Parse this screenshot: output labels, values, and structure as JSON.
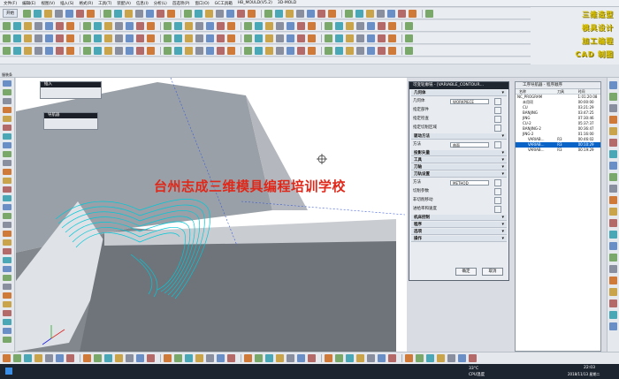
{
  "menu": [
    "文件(F)",
    "编辑(E)",
    "视图(V)",
    "插入(S)",
    "格式(R)",
    "工具(T)",
    "装配(A)",
    "信息(I)",
    "分析(L)",
    "首选项(P)",
    "窗口(O)",
    "GC工具箱",
    "HB_MOULD(V5.2)",
    "3D-MOLD"
  ],
  "start_label": "开始",
  "cad_lines": [
    "三维造型",
    "模具设计",
    "加工编程",
    "CAD 制图"
  ],
  "resource_bar_label": "服装条",
  "watermark": "台州志成三维模具编程培训学校",
  "float_insert_title": "插入",
  "float_nav_title": "导航器",
  "dialog": {
    "title": "可变轮廓铣 - [VARIABLE_CONTOUR…",
    "sec_geometry": "几何体",
    "geometry_label": "几何体",
    "geometry_value": "WORKPIECE",
    "part_label": "指定部件",
    "check_label": "指定检查",
    "cut_area_label": "指定切削区域",
    "sec_drive": "驱动方法",
    "method_label": "方法",
    "method_value": "曲面",
    "sec_proj": "投影矢量",
    "sec_tool": "工具",
    "sec_axis": "刀轴",
    "sec_ops": "刀轨设置",
    "ops_method_label": "方法",
    "ops_method_value": "METHOD",
    "cut_param_label": "切削参数",
    "noncut_label": "非切削移动",
    "feed_label": "进给率和速度",
    "sec_machine": "机床控制",
    "sec_program": "程序",
    "sec_options": "选项",
    "sec_actions": "操作",
    "ok": "确定",
    "cancel": "取消"
  },
  "nav": {
    "title": "工序导航器 - 程序顺序",
    "columns": [
      "名称",
      "刀具",
      "时间"
    ],
    "rows": [
      {
        "name": "NC_PROGRAM",
        "tool": "",
        "time": "1:01:20:08"
      },
      {
        "name": "未用项",
        "tool": "",
        "time": "00:00:00"
      },
      {
        "name": "CU",
        "tool": "",
        "time": "03:21:29"
      },
      {
        "name": "BANJING",
        "tool": "",
        "time": "03:47:25"
      },
      {
        "name": "JING",
        "tool": "",
        "time": "07:30:46"
      },
      {
        "name": "CU-2",
        "tool": "",
        "time": "05:37:37"
      },
      {
        "name": "BANJING-2",
        "tool": "",
        "time": "00:36:47"
      },
      {
        "name": "JING-2",
        "tool": "",
        "time": "01:16:00"
      },
      {
        "name": "VARIAB...",
        "tool": "R3",
        "time": "00:46:02"
      },
      {
        "name": "VARIAB...",
        "tool": "R3",
        "time": "00:10:29",
        "selected": true
      },
      {
        "name": "VARIAB...",
        "tool": "R3",
        "time": "00:19:29"
      }
    ]
  },
  "taskbar": {
    "temp": "33°C",
    "cpu": "CPU温度",
    "time": "22:03",
    "date": "2018/11/13 星期二"
  },
  "colors": {
    "accent": "#0a64c8",
    "title_bar": "#1f2630",
    "watermark": "#e0281a",
    "model_gray": "#8a8f96",
    "toolpath_cyan": "#00c8d8"
  }
}
